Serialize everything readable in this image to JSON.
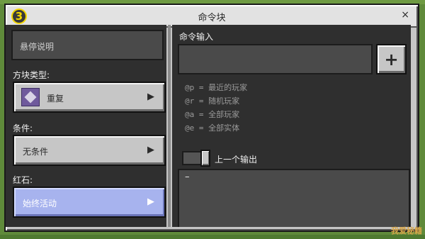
{
  "window": {
    "title": "命令块",
    "step_badge": "3",
    "close_glyph": "×"
  },
  "left": {
    "hover_placeholder": "悬停说明",
    "block_type": {
      "label": "方块类型:",
      "value": "重复",
      "icon": "repeating-command-block-icon"
    },
    "condition": {
      "label": "条件:",
      "value": "无条件"
    },
    "redstone": {
      "label": "红石:",
      "value": "始终活动"
    },
    "chevron": "▶"
  },
  "right": {
    "command_input_label": "命令输入",
    "command_input_value": "",
    "add_button": "+",
    "hints": [
      "@p = 最近的玩家",
      "@r = 随机玩家",
      "@a = 全部玩家",
      "@e = 全部实体"
    ],
    "previous_output": {
      "label": "上一个输出",
      "enabled": true,
      "text": "–"
    }
  },
  "watermark": "我爱秘籍",
  "colors": {
    "active_button": "#a7b3ee",
    "badge": "#f3d600"
  }
}
